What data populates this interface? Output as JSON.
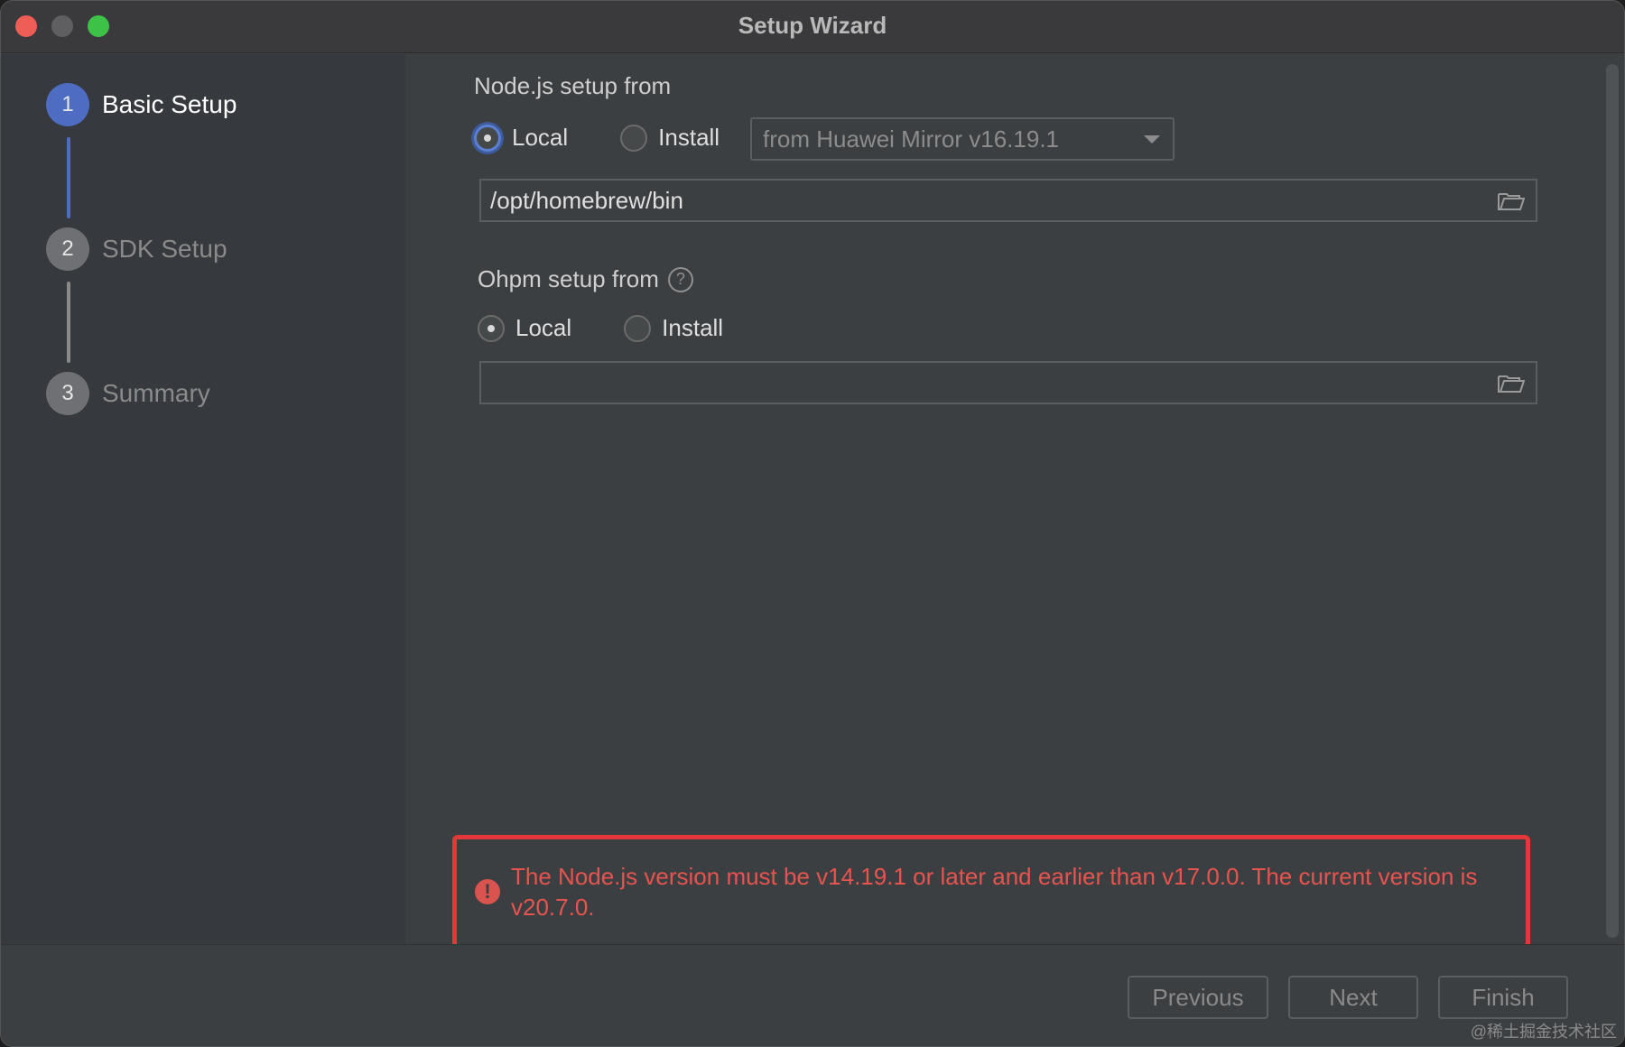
{
  "window": {
    "title": "Setup Wizard"
  },
  "steps": [
    {
      "number": "1",
      "label": "Basic Setup",
      "active": true
    },
    {
      "number": "2",
      "label": "SDK Setup",
      "active": false
    },
    {
      "number": "3",
      "label": "Summary",
      "active": false
    }
  ],
  "nodejs": {
    "title": "Node.js setup from",
    "options": [
      "Local",
      "Install"
    ],
    "selected": "Local",
    "mirror": "from Huawei Mirror v16.19.1",
    "path": "/opt/homebrew/bin"
  },
  "ohpm": {
    "title": "Ohpm setup from",
    "help": "?",
    "options": [
      "Local",
      "Install"
    ],
    "selected": "Local",
    "path": ""
  },
  "error": {
    "icon": "!",
    "message": "The Node.js version must be v14.19.1 or later and earlier than v17.0.0. The current version is v20.7.0."
  },
  "footer": {
    "previous": "Previous",
    "next": "Next",
    "finish": "Finish",
    "watermark": "@稀土掘金技术社区"
  },
  "colors": {
    "accent": "#4e6cc2",
    "error": "#e5363b"
  }
}
